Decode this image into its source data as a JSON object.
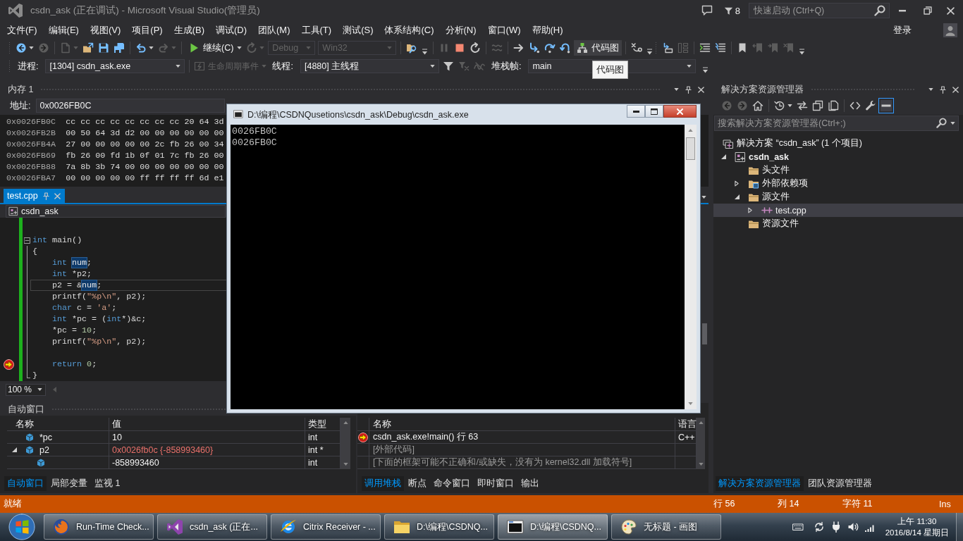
{
  "window": {
    "title": "csdn_ask (正在调试) - Microsoft Visual Studio(管理员)",
    "notification_count": "8",
    "quick_launch": {
      "placeholder": "快速启动 (Ctrl+Q)"
    }
  },
  "menu": [
    "文件(F)",
    "编辑(E)",
    "视图(V)",
    "项目(P)",
    "生成(B)",
    "调试(D)",
    "团队(M)",
    "工具(T)",
    "测试(S)",
    "体系结构(C)",
    "分析(N)",
    "窗口(W)",
    "帮助(H)"
  ],
  "account": {
    "label": "登录"
  },
  "toolbar": {
    "items": [
      {
        "kind": "back",
        "disabled": false,
        "dropdown": true
      },
      {
        "kind": "forward",
        "disabled": true
      },
      {
        "kind": "separator"
      },
      {
        "kind": "new-project",
        "disabled": true,
        "dropdown": true
      },
      {
        "kind": "open",
        "disabled": false
      },
      {
        "kind": "save",
        "disabled": false
      },
      {
        "kind": "save-all",
        "disabled": false
      },
      {
        "kind": "separator"
      },
      {
        "kind": "undo",
        "disabled": false,
        "dropdown": true
      },
      {
        "kind": "redo",
        "disabled": true,
        "dropdown": true
      },
      {
        "kind": "separator"
      },
      {
        "kind": "continue",
        "label": "继续(C)",
        "disabled": false,
        "dropdown": true,
        "highlighted": false
      },
      {
        "kind": "restart-app",
        "disabled": true,
        "dropdown": true
      },
      {
        "kind": "combo",
        "value": "Debug",
        "disabled": true
      },
      {
        "kind": "combo",
        "value": "Win32",
        "disabled": true
      },
      {
        "kind": "separator"
      },
      {
        "kind": "find-in-files",
        "disabled": false
      },
      {
        "kind": "overflow"
      },
      {
        "kind": "separator"
      },
      {
        "kind": "pause",
        "disabled": true
      },
      {
        "kind": "stop",
        "disabled": false
      },
      {
        "kind": "restart",
        "disabled": false
      },
      {
        "kind": "separator"
      },
      {
        "kind": "hot-reload",
        "disabled": true
      },
      {
        "kind": "separator"
      },
      {
        "kind": "show-next",
        "disabled": false
      },
      {
        "kind": "step-into",
        "disabled": false
      },
      {
        "kind": "step-over",
        "disabled": false
      },
      {
        "kind": "step-out",
        "disabled": false
      },
      {
        "kind": "code-map",
        "label": "代码图",
        "disabled": false,
        "highlighted": true
      },
      {
        "kind": "separator"
      },
      {
        "kind": "loop",
        "disabled": false
      },
      {
        "kind": "overflow"
      },
      {
        "kind": "grip"
      },
      {
        "kind": "insert-line",
        "disabled": false
      },
      {
        "kind": "align",
        "disabled": true
      },
      {
        "kind": "separator"
      },
      {
        "kind": "indent",
        "disabled": false
      },
      {
        "kind": "comment",
        "disabled": false
      },
      {
        "kind": "separator"
      },
      {
        "kind": "bookmark",
        "disabled": false
      },
      {
        "kind": "prev-bookmark",
        "disabled": true
      },
      {
        "kind": "next-bookmark",
        "disabled": true
      },
      {
        "kind": "clear-bookmarks",
        "disabled": true
      },
      {
        "kind": "overflow"
      }
    ]
  },
  "debug_location": {
    "process": {
      "label": "进程:",
      "value": "[1304] csdn_ask.exe"
    },
    "lifecycle_events": {
      "label": "生命周期事件",
      "disabled": true
    },
    "thread": {
      "label": "线程:",
      "value": "[4880] 主线程"
    },
    "filters": [
      {
        "kind": "filter",
        "disabled": false
      },
      {
        "kind": "flag-filter",
        "disabled": true
      },
      {
        "kind": "squiggle",
        "disabled": true
      }
    ],
    "stack_frame": {
      "label": "堆栈帧:",
      "value": "main"
    }
  },
  "tooltip": "代码图",
  "memory": {
    "title": "内存 1",
    "address_label": "地址:",
    "address": "0x0026FB0C",
    "rows": [
      {
        "address": "0x0026FB0C",
        "bytes": "cc cc cc cc cc cc cc cc 20 64 3d"
      },
      {
        "address": "0x0026FB2B",
        "bytes": "00 50 64 3d d2 00 00 00 00 00 00"
      },
      {
        "address": "0x0026FB4A",
        "bytes": "27 00 00 00 00 00 2c fb 26 00 34"
      },
      {
        "address": "0x0026FB69",
        "bytes": "fb 26 00 fd 1b 0f 01 7c fb 26 00"
      },
      {
        "address": "0x0026FB88",
        "bytes": "7a 8b 3b 74 00 00 00 00 00 00 00"
      },
      {
        "address": "0x0026FBA7",
        "bytes": "00 00 00 00 00 ff ff ff ff 6d e1"
      }
    ]
  },
  "editor": {
    "tab": {
      "label": "test.cpp",
      "selected": true
    },
    "navigation": "csdn_ask",
    "zoom": "100 %",
    "lines": [
      {
        "kind": "blank"
      },
      {
        "kind": "code",
        "collapsible": true,
        "current": false,
        "highlighted": false,
        "tokens": [
          {
            "text": "int",
            "kind": "keyword"
          },
          {
            "text": " main()",
            "kind": "plain"
          }
        ]
      },
      {
        "kind": "code",
        "current": false,
        "highlighted": false,
        "tokens": [
          {
            "text": "{",
            "kind": "plain"
          }
        ],
        "children": [
          {
            "kind": "code",
            "current": false,
            "highlighted": false,
            "tokens": [
              {
                "text": "int ",
                "kind": "keyword"
              },
              {
                "text": "num",
                "kind": "reference"
              },
              {
                "text": ";",
                "kind": "plain"
              }
            ]
          },
          {
            "kind": "code",
            "current": false,
            "highlighted": false,
            "tokens": [
              {
                "text": "int ",
                "kind": "keyword"
              },
              {
                "text": "*p2;",
                "kind": "plain"
              }
            ]
          },
          {
            "kind": "code",
            "current": false,
            "highlighted": true,
            "tokens": [
              {
                "text": "p2 = &",
                "kind": "plain"
              },
              {
                "text": "num",
                "kind": "reference"
              },
              {
                "text": ";",
                "kind": "plain"
              }
            ]
          },
          {
            "kind": "code",
            "current": false,
            "highlighted": false,
            "tokens": [
              {
                "text": "printf(",
                "kind": "plain"
              },
              {
                "text": "\"%p\\n\"",
                "kind": "string"
              },
              {
                "text": ", p2);",
                "kind": "plain"
              }
            ]
          },
          {
            "kind": "code",
            "current": false,
            "highlighted": false,
            "tokens": [
              {
                "text": "char",
                "kind": "keyword"
              },
              {
                "text": " c = ",
                "kind": "plain"
              },
              {
                "text": "'a'",
                "kind": "string"
              },
              {
                "text": ";",
                "kind": "plain"
              }
            ]
          },
          {
            "kind": "code",
            "current": false,
            "highlighted": false,
            "tokens": [
              {
                "text": "int ",
                "kind": "keyword"
              },
              {
                "text": "*pc = (",
                "kind": "plain"
              },
              {
                "text": "int",
                "kind": "keyword"
              },
              {
                "text": "*)&c;",
                "kind": "plain"
              }
            ]
          },
          {
            "kind": "code",
            "current": false,
            "highlighted": false,
            "tokens": [
              {
                "text": "*pc = ",
                "kind": "plain"
              },
              {
                "text": "10",
                "kind": "number"
              },
              {
                "text": ";",
                "kind": "plain"
              }
            ]
          },
          {
            "kind": "code",
            "current": false,
            "highlighted": false,
            "tokens": [
              {
                "text": "printf(",
                "kind": "plain"
              },
              {
                "text": "\"%p\\n\"",
                "kind": "string"
              },
              {
                "text": ", p2);",
                "kind": "plain"
              }
            ]
          },
          {
            "kind": "blank"
          },
          {
            "kind": "code",
            "current": true,
            "highlighted": false,
            "tokens": [
              {
                "text": "return ",
                "kind": "keyword"
              },
              {
                "text": "0",
                "kind": "number"
              },
              {
                "text": ";",
                "kind": "plain"
              }
            ]
          }
        ]
      },
      {
        "kind": "code",
        "current": false,
        "highlighted": false,
        "tokens": [
          {
            "text": "}",
            "kind": "plain"
          }
        ]
      }
    ]
  },
  "console": {
    "title": "D:\\编程\\CSDNQusetions\\csdn_ask\\Debug\\csdn_ask.exe",
    "output": [
      "0026FB0C",
      "0026FB0C"
    ]
  },
  "autos": {
    "title": "自动窗口",
    "columns": [
      "名称",
      "值",
      "类型"
    ],
    "rows": [
      {
        "name": "*pc",
        "value": "10",
        "type": "int",
        "changed": false
      },
      {
        "name": "p2",
        "value": "0x0026fb0c {-858993460}",
        "type": "int *",
        "changed": true,
        "expanded": true,
        "children": [
          {
            "value": "-858993460",
            "type": "int",
            "changed": false
          }
        ]
      }
    ],
    "tabs": [
      {
        "label": "自动窗口",
        "selected": true
      },
      {
        "label": "局部变量",
        "selected": false
      },
      {
        "label": "监视 1",
        "selected": false
      }
    ]
  },
  "call_stack": {
    "columns": [
      "名称",
      "语言"
    ],
    "frames": [
      {
        "name": "csdn_ask.exe!main() 行 63",
        "language": "C++",
        "current": true,
        "external": false
      },
      {
        "name": "[外部代码]",
        "current": false,
        "external": true
      },
      {
        "name": "[下面的框架可能不正确和/或缺失，没有为 kernel32.dll 加载符号]",
        "current": false,
        "external": true
      }
    ],
    "tabs": [
      {
        "label": "调用堆栈",
        "selected": true
      },
      {
        "label": "断点",
        "selected": false
      },
      {
        "label": "命令窗口",
        "selected": false
      },
      {
        "label": "即时窗口",
        "selected": false
      },
      {
        "label": "输出",
        "selected": false
      }
    ]
  },
  "solution_explorer": {
    "title": "解决方案资源管理器",
    "toolbar": [
      {
        "kind": "back",
        "disabled": true,
        "selected": false
      },
      {
        "kind": "forward",
        "disabled": true,
        "selected": false
      },
      {
        "kind": "home",
        "disabled": false,
        "selected": false
      },
      {
        "kind": "separator"
      },
      {
        "kind": "pending-changes",
        "disabled": false,
        "selected": false,
        "dropdown": true
      },
      {
        "kind": "sync",
        "disabled": false,
        "selected": false
      },
      {
        "kind": "collapse-all",
        "disabled": false,
        "selected": false
      },
      {
        "kind": "show-all-files",
        "disabled": false,
        "selected": false
      },
      {
        "kind": "separator"
      },
      {
        "kind": "code-view",
        "disabled": false,
        "selected": false
      },
      {
        "kind": "properties",
        "disabled": false,
        "selected": false
      },
      {
        "kind": "preview",
        "disabled": false,
        "selected": true
      }
    ],
    "search": {
      "placeholder": "搜索解决方案资源管理器(Ctrl+;)"
    },
    "tree": [
      {
        "label": "解决方案 “csdn_ask” (1 个项目)",
        "kind": "solution",
        "selected": false,
        "children": [
          {
            "label": "csdn_ask",
            "kind": "project",
            "selected": false,
            "expanded": true,
            "children": [
              {
                "label": "头文件",
                "kind": "filter",
                "selected": false
              },
              {
                "label": "外部依赖项",
                "kind": "dependencies",
                "selected": false,
                "expanded": false
              },
              {
                "label": "源文件",
                "kind": "filter",
                "selected": false,
                "expanded": true,
                "children": [
                  {
                    "label": "test.cpp",
                    "kind": "file",
                    "selected": true,
                    "expanded": false
                  }
                ]
              },
              {
                "label": "资源文件",
                "kind": "filter",
                "selected": false
              }
            ]
          }
        ]
      }
    ],
    "tabs": [
      {
        "label": "解决方案资源管理器",
        "selected": true
      },
      {
        "label": "团队资源管理器",
        "selected": false
      }
    ]
  },
  "status_bar": {
    "message": "就绪",
    "line": "行 56",
    "column": "列 14",
    "character": "字符 11",
    "mode": "Ins"
  },
  "taskbar": {
    "buttons": [
      {
        "label": "Run-Time Check...",
        "kind": "firefox",
        "selected": false
      },
      {
        "label": "csdn_ask (正在...",
        "kind": "visual-studio",
        "selected": false
      },
      {
        "label": "Citrix Receiver - ...",
        "kind": "ie",
        "selected": false
      },
      {
        "label": "D:\\编程\\CSDNQ...",
        "kind": "explorer",
        "selected": false
      },
      {
        "label": "D:\\编程\\CSDNQ...",
        "kind": "console",
        "selected": true
      },
      {
        "label": "无标题 - 画图",
        "kind": "paint",
        "selected": false
      }
    ],
    "clock": {
      "time": "上午 11:30",
      "date": "2016/8/14 星期日"
    }
  }
}
